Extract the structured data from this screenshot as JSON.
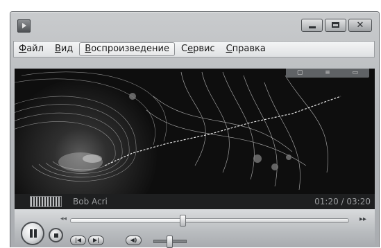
{
  "window": {
    "icon": "media-player-icon",
    "buttons": [
      "minimize-icon",
      "maximize-icon",
      "close-icon"
    ],
    "close_glyph": "✕"
  },
  "menu": {
    "items": [
      {
        "label_ul": "Ф",
        "label_rest": "айл"
      },
      {
        "label_ul": "В",
        "label_rest": "ид"
      },
      {
        "label_ul": "В",
        "label_rest": "оспроизведение"
      },
      {
        "label_pre": "С",
        "label_ul": "е",
        "label_rest": "рвис"
      },
      {
        "label_ul": "С",
        "label_rest": "правка"
      }
    ],
    "active_index": 2
  },
  "video": {
    "mini_controls": [
      "▢",
      "≡",
      "▭"
    ]
  },
  "now_playing": {
    "artist": "Bob Acri",
    "time": "01:20 / 03:20"
  },
  "transport": {
    "progress": 0.4,
    "volume": 0.45,
    "prev_glyph": "|◀",
    "next_glyph": "▶|",
    "mute_glyph": "◀)",
    "seek_back_glyph": "◂◂",
    "seek_fwd_glyph": "▸▸"
  },
  "colors": {
    "window_chrome": "#b7babd",
    "video_bg": "#101010",
    "visualization_stroke": "#d8d8d8"
  }
}
